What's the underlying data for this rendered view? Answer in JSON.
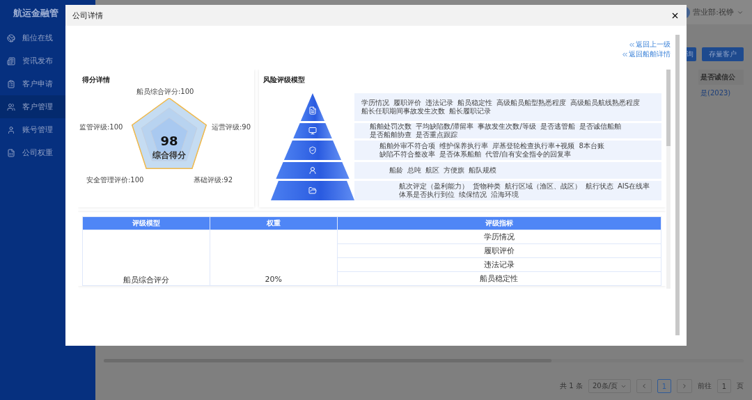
{
  "sidebar": {
    "title": "航运金融管",
    "items": [
      {
        "label": "船位在线",
        "selected": false
      },
      {
        "label": "资讯发布",
        "selected": false
      },
      {
        "label": "客户申请",
        "selected": false
      },
      {
        "label": "客户管理",
        "selected": true
      },
      {
        "label": "账号管理",
        "selected": false
      },
      {
        "label": "公司权重",
        "selected": false
      }
    ]
  },
  "header": {
    "user": "营业部:祝铮"
  },
  "toolbar": {
    "buttons": [
      "询",
      "存量客户"
    ]
  },
  "table": {
    "columns": [
      "是否诚信公"
    ],
    "rows": [
      [
        "是(2023)"
      ]
    ]
  },
  "pagination": {
    "total": "共 1 条",
    "page_size": "20条/页",
    "pages": [
      {
        "label": "1",
        "selected": true
      }
    ],
    "goto_label": "前往",
    "goto_value": "1",
    "goto_suffix": "页"
  },
  "dialog": {
    "title": "公司详情",
    "links": [
      "返回上一级",
      "返回船舶详情"
    ],
    "score_card": {
      "title": "得分详情",
      "score": "98",
      "score_label": "综合得分",
      "axes": [
        "船员综合评分:100",
        "监管评级:100",
        "运营评级:90",
        "安全管理评价:100",
        "基础评级:92"
      ]
    },
    "risk_model": {
      "title": "风险评级模型",
      "tiers": [
        {
          "items": [
            "学历情况",
            "履职评价",
            "违法记录",
            "船员稳定性",
            "高级船员船型熟悉程度",
            "高级船员航线熟悉程度",
            "船长任职期间事故发生次数",
            "船长履职记录"
          ]
        },
        {
          "items": [
            "船舶处罚次数",
            "平均缺陷数/滞留率",
            "事故发生次数/等级",
            "是否逃管船",
            "是否诚信船舶",
            "是否船舶协查",
            "是否重点跟踪"
          ]
        },
        {
          "items": [
            "船舶外审不符合项",
            "维护保养执行率",
            "岸基登轮检查执行率+视频",
            "8本台账",
            "缺陷不符合整改率",
            "是否体系船舶",
            "代管/自有安全指令的回复率"
          ]
        },
        {
          "items": [
            "船龄",
            "总吨",
            "航区",
            "方便旗",
            "船队规模"
          ]
        },
        {
          "items": [
            "航次评定（盈利能力）",
            "货物种类",
            "航行区域（渔区、战区）",
            "航行状态",
            "AIS在线率",
            "体系是否执行到位",
            "续保情况",
            "沿海环境"
          ]
        }
      ]
    },
    "weights_table": {
      "columns": [
        "评级模型",
        "权重",
        "评级指标"
      ],
      "groups": [
        {
          "model": "船员综合评分",
          "weight": "20%",
          "indicators": [
            "学历情况",
            "履职评价",
            "违法记录",
            "船员稳定性"
          ]
        }
      ]
    }
  }
}
